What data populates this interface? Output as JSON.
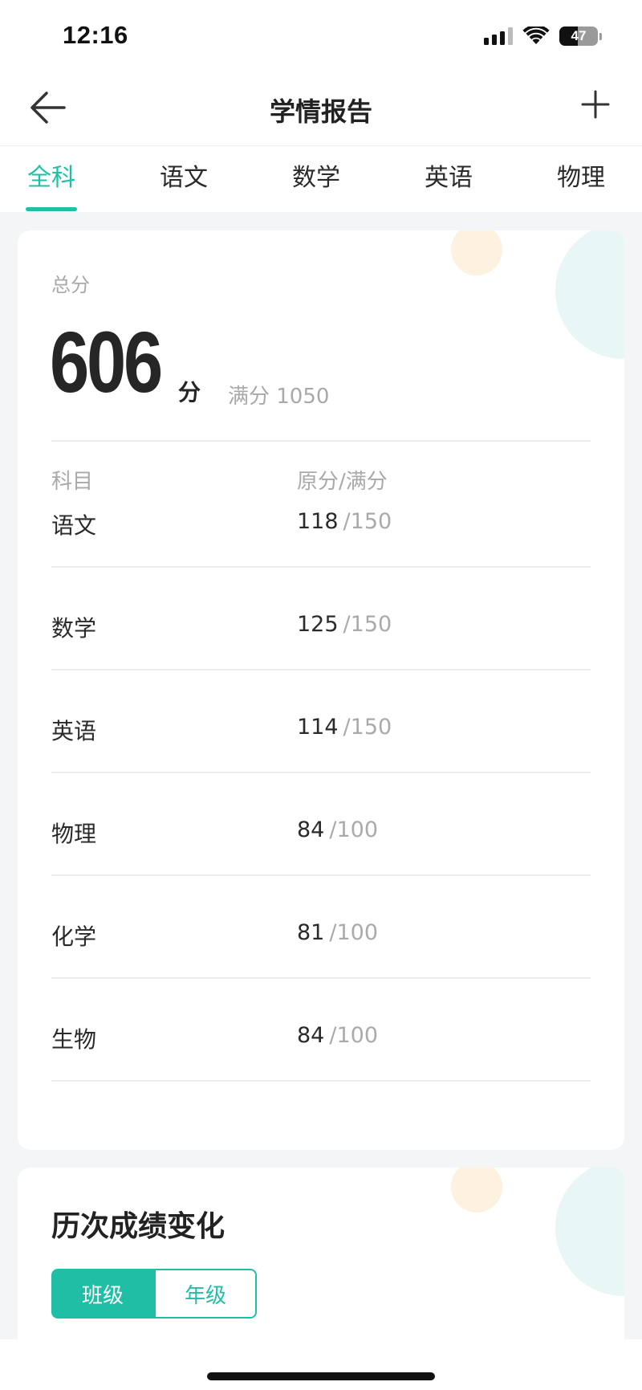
{
  "status_bar": {
    "time": "12:16",
    "battery": "47",
    "battery_level": 0.47
  },
  "nav": {
    "title": "学情报告",
    "back_icon": "arrow-left-icon",
    "add_icon": "plus-icon"
  },
  "tabs": [
    {
      "label": "全科",
      "active": true
    },
    {
      "label": "语文",
      "active": false
    },
    {
      "label": "数学",
      "active": false
    },
    {
      "label": "英语",
      "active": false
    },
    {
      "label": "物理",
      "active": false
    }
  ],
  "summary": {
    "total_label": "总分",
    "total_score": "606",
    "unit": "分",
    "full_score": "满分 1050"
  },
  "table": {
    "headers": {
      "subject": "科目",
      "score": "原分/满分"
    },
    "rows": [
      {
        "subject": "语文",
        "score": "118",
        "full": "/150"
      },
      {
        "subject": "数学",
        "score": "125",
        "full": "/150"
      },
      {
        "subject": "英语",
        "score": "114",
        "full": "/150"
      },
      {
        "subject": "物理",
        "score": "84",
        "full": "/100"
      },
      {
        "subject": "化学",
        "score": "81",
        "full": "/100"
      },
      {
        "subject": "生物",
        "score": "84",
        "full": "/100"
      }
    ]
  },
  "history": {
    "title": "历次成绩变化",
    "segments": [
      {
        "label": "班级",
        "active": true
      },
      {
        "label": "年级",
        "active": false
      }
    ]
  },
  "colors": {
    "accent": "#1fbfa6",
    "muted_text": "#a9a9a9",
    "background": "#f3f5f7"
  }
}
